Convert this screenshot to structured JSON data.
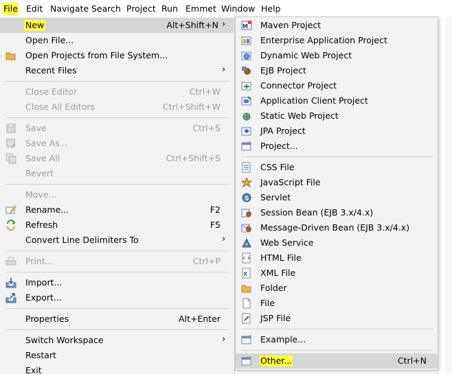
{
  "menubar": {
    "items": [
      "File",
      "Edit",
      "Navigate",
      "Search",
      "Project",
      "Run",
      "Emmet",
      "Window",
      "Help"
    ]
  },
  "file_menu": {
    "items": [
      {
        "label": "New",
        "accel": "Alt+Shift+N",
        "submenu_arrow": "›",
        "icon": "none"
      },
      {
        "label": "Open File...",
        "accel": "",
        "icon": "none"
      },
      {
        "label": "Open Projects from File System...",
        "accel": "",
        "icon": "folder-icon"
      },
      {
        "label": "Recent Files",
        "accel": "",
        "submenu_arrow": "›",
        "icon": "none"
      },
      {
        "label": "Close Editor",
        "accel": "Ctrl+W",
        "disabled": true
      },
      {
        "label": "Close All Editors",
        "accel": "Ctrl+Shift+W",
        "disabled": true
      },
      {
        "label": "Save",
        "accel": "Ctrl+S",
        "disabled": true,
        "icon": "save-icon"
      },
      {
        "label": "Save As...",
        "accel": "",
        "disabled": true,
        "icon": "save-as-icon"
      },
      {
        "label": "Save All",
        "accel": "Ctrl+Shift+S",
        "disabled": true,
        "icon": "save-all-icon"
      },
      {
        "label": "Revert",
        "accel": "",
        "disabled": true
      },
      {
        "label": "Move...",
        "accel": "",
        "disabled": true
      },
      {
        "label": "Rename...",
        "accel": "F2",
        "icon": "rename-icon"
      },
      {
        "label": "Refresh",
        "accel": "F5",
        "icon": "refresh-icon"
      },
      {
        "label": "Convert Line Delimiters To",
        "accel": "",
        "submenu_arrow": "›"
      },
      {
        "label": "Print...",
        "accel": "Ctrl+P",
        "disabled": true,
        "icon": "print-icon"
      },
      {
        "label": "Import...",
        "accel": "",
        "icon": "import-icon"
      },
      {
        "label": "Export...",
        "accel": "",
        "icon": "export-icon"
      },
      {
        "label": "Properties",
        "accel": "Alt+Enter"
      },
      {
        "label": "Switch Workspace",
        "accel": "",
        "submenu_arrow": "›"
      },
      {
        "label": "Restart",
        "accel": ""
      },
      {
        "label": "Exit",
        "accel": ""
      }
    ]
  },
  "new_submenu": {
    "items": [
      {
        "label": "Maven Project",
        "icon": "maven-project-icon"
      },
      {
        "label": "Enterprise Application Project",
        "icon": "enterprise-app-project-icon"
      },
      {
        "label": "Dynamic Web Project",
        "icon": "dynamic-web-project-icon"
      },
      {
        "label": "EJB Project",
        "icon": "ejb-project-icon"
      },
      {
        "label": "Connector Project",
        "icon": "connector-project-icon"
      },
      {
        "label": "Application Client Project",
        "icon": "app-client-project-icon"
      },
      {
        "label": "Static Web Project",
        "icon": "static-web-project-icon"
      },
      {
        "label": "JPA Project",
        "icon": "jpa-project-icon"
      },
      {
        "label": "Project...",
        "icon": "project-icon"
      },
      {
        "label": "CSS File",
        "icon": "css-file-icon"
      },
      {
        "label": "JavaScript File",
        "icon": "javascript-file-icon"
      },
      {
        "label": "Servlet",
        "icon": "servlet-icon"
      },
      {
        "label": "Session Bean (EJB 3.x/4.x)",
        "icon": "session-bean-icon"
      },
      {
        "label": "Message-Driven Bean (EJB 3.x/4.x)",
        "icon": "message-driven-bean-icon"
      },
      {
        "label": "Web Service",
        "icon": "web-service-icon"
      },
      {
        "label": "HTML File",
        "icon": "html-file-icon"
      },
      {
        "label": "XML File",
        "icon": "xml-file-icon"
      },
      {
        "label": "Folder",
        "icon": "folder-icon"
      },
      {
        "label": "File",
        "icon": "file-icon"
      },
      {
        "label": "JSP File",
        "icon": "jsp-file-icon"
      },
      {
        "label": "Example...",
        "icon": "example-icon"
      },
      {
        "label": "Other...",
        "accel": "Ctrl+N",
        "icon": "other-icon"
      }
    ]
  },
  "colors": {
    "highlight": "#ffff33",
    "menu_bg": "#f2f2f2",
    "selected_bg": "#d6d6d6",
    "disabled_text": "#9d9d9d"
  }
}
